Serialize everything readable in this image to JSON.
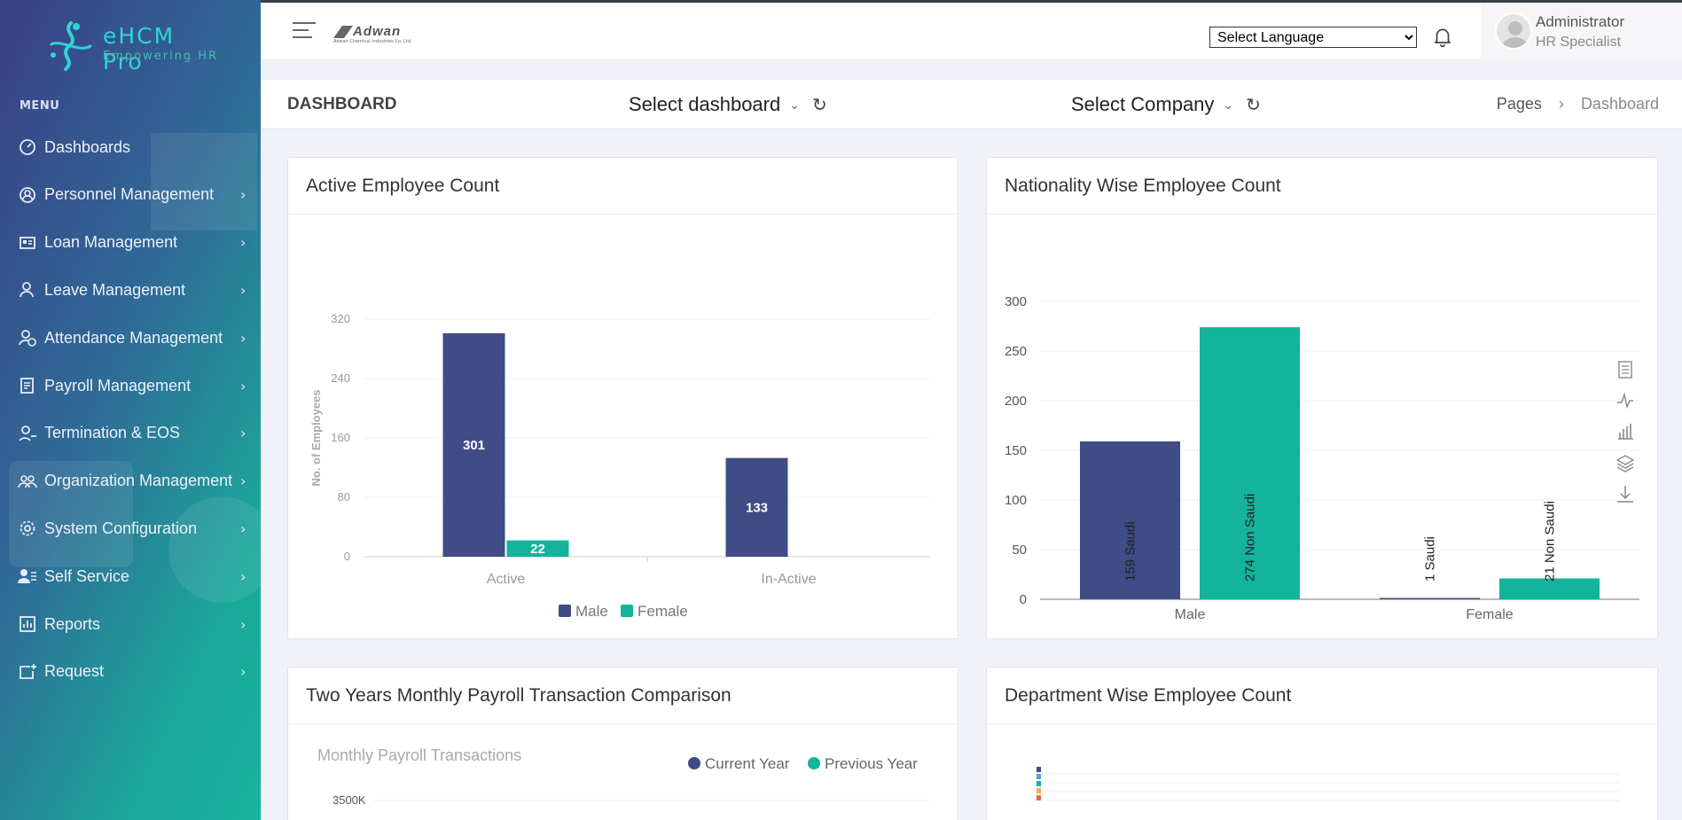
{
  "app": {
    "logo_title": "eHCM Pro",
    "logo_subtitle": "Empowering HR",
    "brand_name": "Adwan",
    "brand_sub": "Adwan Chemical Industries Co. Ltd."
  },
  "sidebar": {
    "menu_label": "MENU",
    "items": [
      {
        "label": "Dashboards",
        "icon": "dashboard-icon",
        "chevron": false
      },
      {
        "label": "Personnel Management",
        "icon": "user-circle-icon",
        "chevron": true
      },
      {
        "label": "Loan Management",
        "icon": "id-card-icon",
        "chevron": true
      },
      {
        "label": "Leave Management",
        "icon": "user-leave-icon",
        "chevron": true
      },
      {
        "label": "Attendance Management",
        "icon": "user-clock-icon",
        "chevron": true
      },
      {
        "label": "Payroll Management",
        "icon": "document-icon",
        "chevron": true
      },
      {
        "label": "Termination & EOS",
        "icon": "user-minus-icon",
        "chevron": true
      },
      {
        "label": "Organization Management",
        "icon": "users-icon",
        "chevron": true
      },
      {
        "label": "System Configuration",
        "icon": "gear-icon",
        "chevron": true
      },
      {
        "label": "Self Service",
        "icon": "user-list-icon",
        "chevron": true
      },
      {
        "label": "Reports",
        "icon": "report-icon",
        "chevron": true
      },
      {
        "label": "Request",
        "icon": "request-icon",
        "chevron": true
      }
    ]
  },
  "header": {
    "language_select": "Select Language",
    "user_name": "Administrator",
    "user_role": "HR Specialist"
  },
  "titlebar": {
    "title": "DASHBOARD",
    "dashboard_dropdown": "Select dashboard",
    "company_dropdown": "Select Company",
    "breadcrumb": [
      "Pages",
      "Dashboard"
    ]
  },
  "cards": {
    "active_employee": "Active Employee Count",
    "nationality": "Nationality Wise Employee Count",
    "payroll": "Two Years Monthly Payroll Transaction Comparison",
    "department": "Department Wise Employee Count"
  },
  "colors": {
    "male": "#3f4c85",
    "female": "#13b39c"
  },
  "chart_data": [
    {
      "type": "bar",
      "title": "Active Employee Count",
      "categories": [
        "Active",
        "In-Active"
      ],
      "series": [
        {
          "name": "Male",
          "values": [
            301,
            133
          ]
        },
        {
          "name": "Female",
          "values": [
            22,
            0
          ]
        }
      ],
      "ylabel": "No. of Employees",
      "ylim": [
        0,
        320
      ],
      "yticks": [
        0,
        80,
        160,
        240,
        320
      ],
      "grid": true,
      "legend": "bottom"
    },
    {
      "type": "bar",
      "title": "Nationality Wise Employee Count",
      "categories": [
        "Male",
        "Female"
      ],
      "series": [
        {
          "values": [
            159,
            1
          ],
          "labels": [
            "159 Saudi",
            "1 Saudi"
          ]
        },
        {
          "values": [
            274,
            21
          ],
          "labels": [
            "274 Non Saudi",
            "21 Non Saudi"
          ]
        }
      ],
      "ylim": [
        0,
        300
      ],
      "yticks": [
        0,
        50,
        100,
        150,
        200,
        250,
        300
      ],
      "grid": true,
      "toolbox": [
        "data-view-icon",
        "line-chart-icon",
        "bar-chart-icon",
        "stack-icon",
        "download-icon"
      ]
    },
    {
      "type": "line",
      "title": "Monthly Payroll Transactions",
      "series": [
        {
          "name": "Current Year"
        },
        {
          "name": "Previous Year"
        }
      ],
      "yticks_visible": [
        "3500K"
      ],
      "legend": "top-right"
    }
  ]
}
